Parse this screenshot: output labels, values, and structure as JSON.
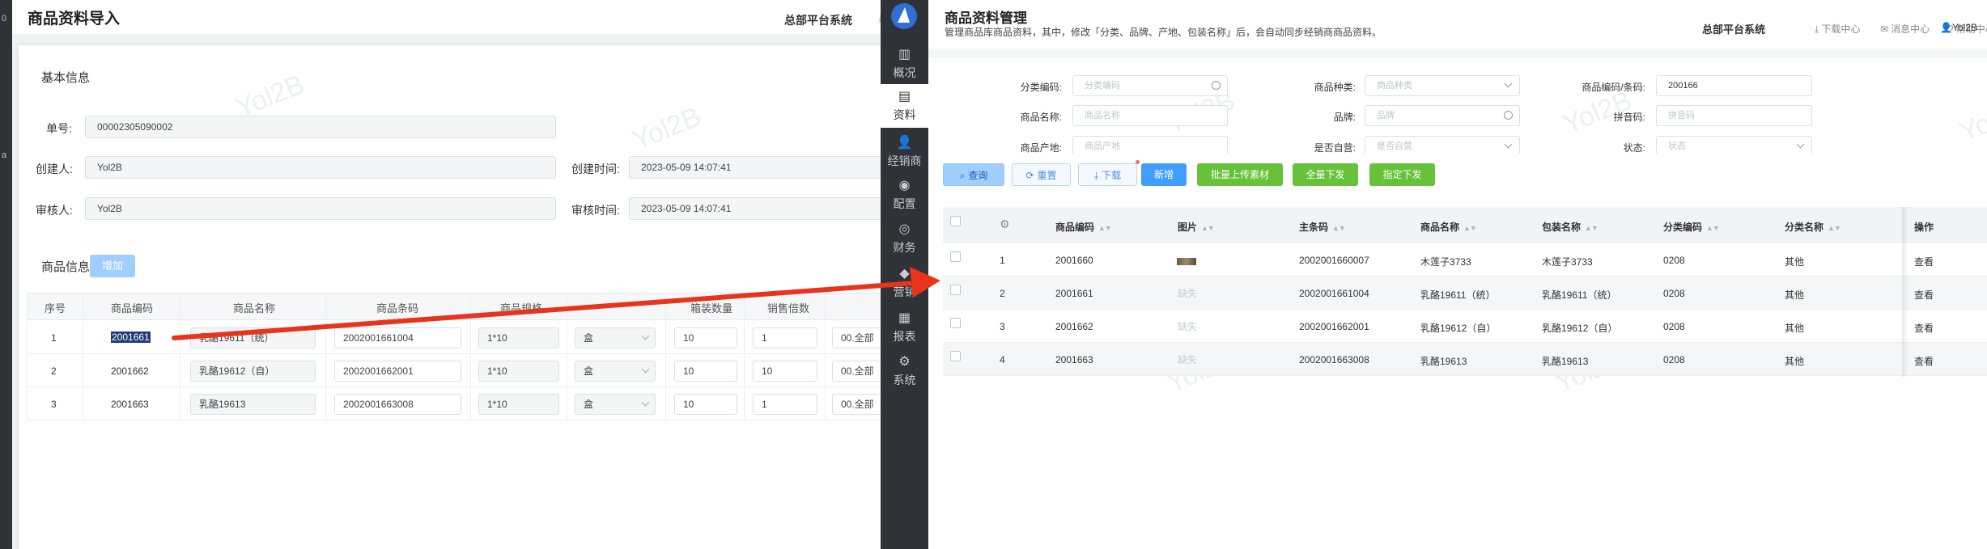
{
  "left": {
    "header": {
      "title": "商品资料导入",
      "hq_label": "总部平台系统",
      "download_glyph": "⤓"
    },
    "basic_section": {
      "title": "基本信息",
      "order_no_label": "单号:",
      "order_no_value": "00002305090002",
      "creator_label": "创建人:",
      "creator_value": "Yol2B",
      "created_time_label": "创建时间:",
      "created_time_value": "2023-05-09 14:07:41",
      "reviewer_label": "审核人:",
      "reviewer_value": "Yol2B",
      "review_time_label": "审核时间:",
      "review_time_value": "2023-05-09 14:07:41"
    },
    "goods_section": {
      "title": "商品信息",
      "add_label": "增加"
    },
    "table": {
      "headers": [
        "序号",
        "商品编码",
        "商品名称",
        "商品条码",
        "商品规格",
        "",
        "箱装数量",
        "销售倍数"
      ],
      "rows": [
        {
          "seq": "1",
          "code": "2001661",
          "name": "乳酪19611（统）",
          "barcode": "2002001661004",
          "spec": "1*10",
          "unit": "盒",
          "box_qty": "10",
          "multiple": "1",
          "extra": "00.全部"
        },
        {
          "seq": "2",
          "code": "2001662",
          "name": "乳酪19612（自）",
          "barcode": "2002001662001",
          "spec": "1*10",
          "unit": "盒",
          "box_qty": "10",
          "multiple": "10",
          "extra": "00.全部"
        },
        {
          "seq": "3",
          "code": "2001663",
          "name": "乳酪19613",
          "barcode": "2002001663008",
          "spec": "1*10",
          "unit": "盒",
          "box_qty": "10",
          "multiple": "1",
          "extra": "00.全部"
        }
      ]
    },
    "rail_glyphs": [
      "0",
      "a"
    ],
    "watermark": "Yol2B"
  },
  "right": {
    "sidebar": {
      "items": [
        {
          "icon": "▥",
          "icon_name": "overview-icon",
          "label": "概况"
        },
        {
          "icon": "▤",
          "icon_name": "document-icon",
          "label": "资料"
        },
        {
          "icon": "👤",
          "icon_name": "dealer-icon",
          "label": "经销商"
        },
        {
          "icon": "◉",
          "icon_name": "config-icon",
          "label": "配置"
        },
        {
          "icon": "◎",
          "icon_name": "finance-icon",
          "label": "财务"
        },
        {
          "icon": "◆",
          "icon_name": "goods-icon",
          "label": "营销"
        },
        {
          "icon": "▦",
          "icon_name": "report-icon",
          "label": "报表"
        },
        {
          "icon": "⚙",
          "icon_name": "system-icon",
          "label": "系统"
        }
      ]
    },
    "header": {
      "title": "商品资料管理",
      "subtitle": "管理商品库商品资料，其中，修改「分类、品牌、产地、包装名称」后，会自动同步经销商商品资料。",
      "hq_label": "总部平台系统",
      "links": [
        {
          "icon": "⤓",
          "label": "下载中心"
        },
        {
          "icon": "✉",
          "label": "消息中心"
        },
        {
          "icon": "?",
          "label": "帮助中心"
        }
      ],
      "user_icon": "👤",
      "user": "Yol2B"
    },
    "filters": {
      "category_code_label": "分类编码:",
      "category_code_placeholder": "分类编码",
      "goods_type_label": "商品种类:",
      "goods_type_placeholder": "商品种类",
      "goods_code_label": "商品编码/条码:",
      "goods_code_value": "200166",
      "goods_name_label": "商品名称:",
      "goods_name_placeholder": "商品名称",
      "brand_label": "品牌:",
      "brand_placeholder": "品牌",
      "pinyin_label": "拼音码:",
      "pinyin_placeholder": "拼音码",
      "origin_label": "商品产地:",
      "origin_placeholder": "商品产地",
      "self_run_label": "是否自营:",
      "self_run_placeholder": "是否自营",
      "status_label": "状态:",
      "status_placeholder": "状态"
    },
    "buttons": {
      "query": "查询",
      "reset": "重置",
      "download": "下载",
      "add": "新增",
      "batch_upload": "批量上传素材",
      "issue_all": "全量下发",
      "issue_selected": "指定下发"
    },
    "table": {
      "headers": {
        "code": "商品编码",
        "image": "图片",
        "barcode": "主条码",
        "name": "商品名称",
        "package_name": "包装名称",
        "category_code": "分类编码",
        "category_name": "分类名称",
        "operation": "操作"
      },
      "rows": [
        {
          "seq": "1",
          "code": "2001660",
          "image": "",
          "barcode": "2002001660007",
          "name": "木莲子3733",
          "package_name": "木莲子3733",
          "category_code": "0208",
          "category_name": "其他",
          "op": "查看"
        },
        {
          "seq": "2",
          "code": "2001661",
          "image": "缺失",
          "barcode": "2002001661004",
          "name": "乳酪19611（统）",
          "package_name": "乳酪19611（统）",
          "category_code": "0208",
          "category_name": "其他",
          "op": "查看"
        },
        {
          "seq": "3",
          "code": "2001662",
          "image": "缺失",
          "barcode": "2002001662001",
          "name": "乳酪19612（自）",
          "package_name": "乳酪19612（自）",
          "category_code": "0208",
          "category_name": "其他",
          "op": "查看"
        },
        {
          "seq": "4",
          "code": "2001663",
          "image": "缺失",
          "barcode": "2002001663008",
          "name": "乳酪19613",
          "package_name": "乳酪19613",
          "category_code": "0208",
          "category_name": "其他",
          "op": "查看"
        }
      ]
    },
    "watermark": "Yol2B"
  },
  "colors": {
    "arrow": "#e8341c",
    "sidebar_bg": "#2f3237",
    "primary": "#409eff",
    "success": "#67c23a"
  }
}
